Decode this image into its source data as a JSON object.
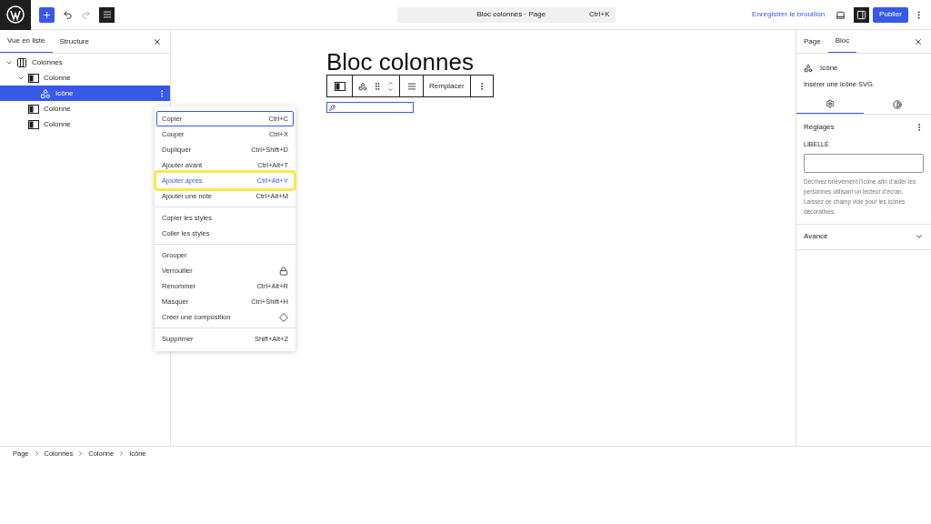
{
  "topbar": {
    "command": {
      "title": "Bloc colonnes · Page",
      "shortcut": "Ctrl+K"
    },
    "save_draft": "Enregistrer le brouillon",
    "publish": "Publier",
    "settings_open": true
  },
  "list_view": {
    "tabs": [
      {
        "label": "Vue en liste",
        "selected": true
      },
      {
        "label": "Structure",
        "selected": false
      }
    ],
    "tree": [
      {
        "label": "Colonnes",
        "kind": "columns",
        "expanded": true,
        "selected": false,
        "children": [
          {
            "label": "Colonne",
            "kind": "column",
            "expanded": true,
            "selected": false,
            "children": [
              {
                "label": "Icône",
                "kind": "icon",
                "selected": true
              }
            ]
          },
          {
            "label": "Colonne",
            "kind": "column",
            "selected": false
          },
          {
            "label": "Colonne",
            "kind": "column",
            "selected": false
          }
        ]
      }
    ]
  },
  "canvas": {
    "title": "Bloc colonnes",
    "toolbar": {
      "replace": "Remplacer"
    }
  },
  "context_menu": {
    "groups": [
      [
        {
          "label": "Copier",
          "shortcut": "Ctrl+C",
          "focused": true,
          "highlighted": false
        },
        {
          "label": "Couper",
          "shortcut": "Ctrl+X",
          "focused": false,
          "highlighted": false
        },
        {
          "label": "Dupliquer",
          "shortcut": "Ctrl+Shift+D",
          "focused": false,
          "highlighted": false
        },
        {
          "label": "Ajouter avant",
          "shortcut": "Ctrl+Alt+T",
          "focused": false,
          "highlighted": false
        },
        {
          "label": "Ajouter après",
          "shortcut": "Ctrl+Alt+Y",
          "focused": false,
          "highlighted": true
        },
        {
          "label": "Ajouter une note",
          "shortcut": "Ctrl+Alt+M",
          "focused": false,
          "highlighted": false
        }
      ],
      [
        {
          "label": "Copier les styles",
          "focused": false,
          "highlighted": false
        },
        {
          "label": "Coller les styles",
          "focused": false,
          "highlighted": false
        }
      ],
      [
        {
          "label": "Grouper",
          "focused": false,
          "highlighted": false
        },
        {
          "label": "Verrouiller",
          "kind": "lock",
          "focused": false,
          "highlighted": false
        },
        {
          "label": "Renommer",
          "shortcut": "Ctrl+Alt+R",
          "focused": false,
          "highlighted": false
        },
        {
          "label": "Masquer",
          "shortcut": "Ctrl+Shift+H",
          "focused": false,
          "highlighted": false
        },
        {
          "label": "Créer une composition",
          "kind": "pattern",
          "focused": false,
          "highlighted": false
        }
      ],
      [
        {
          "label": "Supprimer",
          "shortcut": "Shift+Alt+Z",
          "focused": false,
          "highlighted": false
        }
      ]
    ]
  },
  "inspector": {
    "tabs": [
      {
        "label": "Page",
        "selected": false
      },
      {
        "label": "Bloc",
        "selected": true
      }
    ],
    "block": {
      "name": "Icône",
      "description": "Insérer une icône SVG."
    },
    "subtabs": [
      {
        "kind": "settings",
        "selected": true
      },
      {
        "kind": "styles",
        "selected": false
      }
    ],
    "panel": {
      "title": "Réglages",
      "field_label": "LIBELLÉ",
      "help": "Décrivez brièvement l’icône afin d’aider les personnes utilisant un lecteur d’écran. Laissez ce champ vide pour les icônes décoratives."
    },
    "advanced": {
      "title": "Avancé",
      "expanded": false
    }
  },
  "breadcrumb": [
    "Page",
    "Colonnes",
    "Colonne",
    "Icône"
  ]
}
